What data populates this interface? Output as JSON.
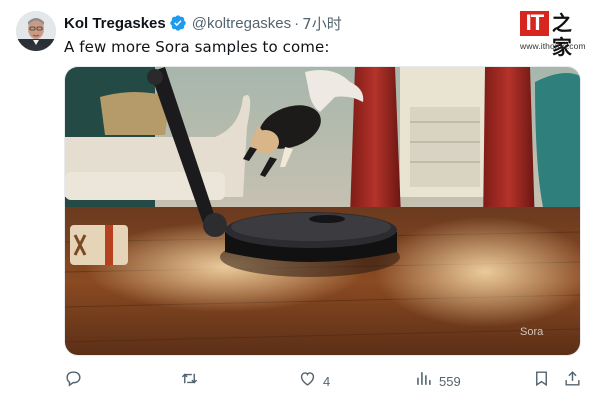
{
  "tweet": {
    "author_name": "Kol Tregaskes",
    "handle": "@koltregaskes",
    "separator": "·",
    "time": "7小时",
    "text": "A few more Sora samples to come:",
    "verified": true
  },
  "watermark": {
    "logo_text": "IT",
    "logo_cn": "之家",
    "url": "www.ithome.com",
    "accent": "#d7261e"
  },
  "media": {
    "video_watermark": "Sora"
  },
  "actions": {
    "reply_count": "",
    "retweet_count": "",
    "like_count": "4",
    "views_count": "559"
  },
  "colors": {
    "verified_blue": "#1d9bf0",
    "text_secondary": "#536471"
  },
  "icons": [
    "verified-badge-icon",
    "reply-icon",
    "retweet-icon",
    "like-icon",
    "views-icon",
    "bookmark-icon",
    "share-icon"
  ]
}
